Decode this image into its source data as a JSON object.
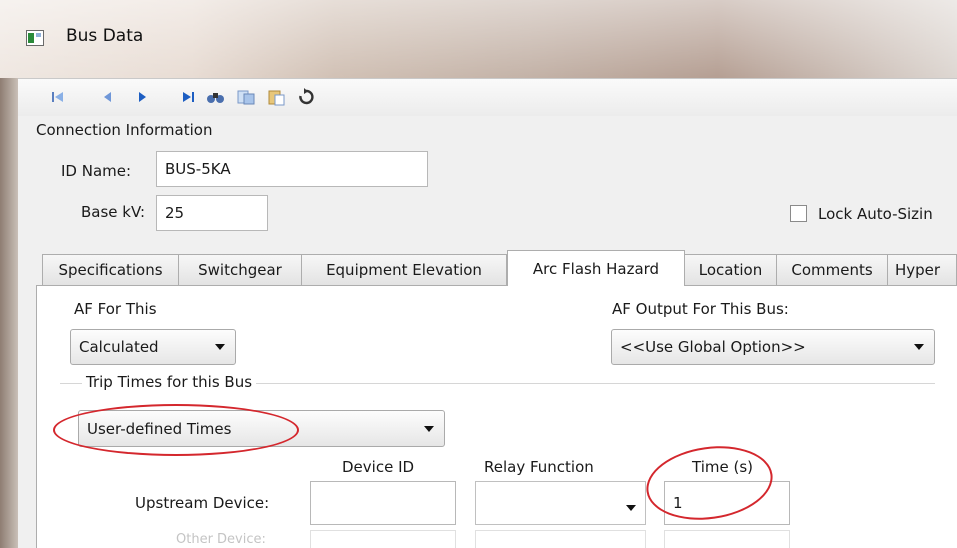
{
  "window": {
    "title": "Bus Data"
  },
  "toolbar": {
    "icons": [
      "first-record-icon",
      "previous-record-icon",
      "next-record-icon",
      "last-record-icon",
      "find-icon",
      "copy-icon",
      "paste-icon",
      "undo-icon"
    ]
  },
  "connection": {
    "section_label": "Connection Information",
    "id_label": "ID Name:",
    "id_value": "BUS-5KA",
    "basekv_label": "Base kV:",
    "basekv_value": "25",
    "lock_label": "Lock Auto-Sizin"
  },
  "tabs": [
    "Specifications",
    "Switchgear",
    "Equipment Elevation",
    "Arc Flash Hazard",
    "Location",
    "Comments",
    "Hyper"
  ],
  "active_tab": "Arc Flash Hazard",
  "arc_flash": {
    "af_label": "AF For This",
    "af_value": "Calculated",
    "output_label": "AF Output For This Bus:",
    "output_value": "<<Use Global Option>>",
    "trip_group_label": "Trip Times for this Bus",
    "trip_value": "User-defined Times",
    "col_device_id": "Device ID",
    "col_relay": "Relay Function",
    "col_time": "Time (s)",
    "upstream_label": "Upstream Device:",
    "upstream_device_id": "",
    "upstream_relay": "",
    "upstream_time": "1",
    "other_label": "Other Device:"
  },
  "colors": {
    "highlight_ellipse": "#d4272d"
  }
}
